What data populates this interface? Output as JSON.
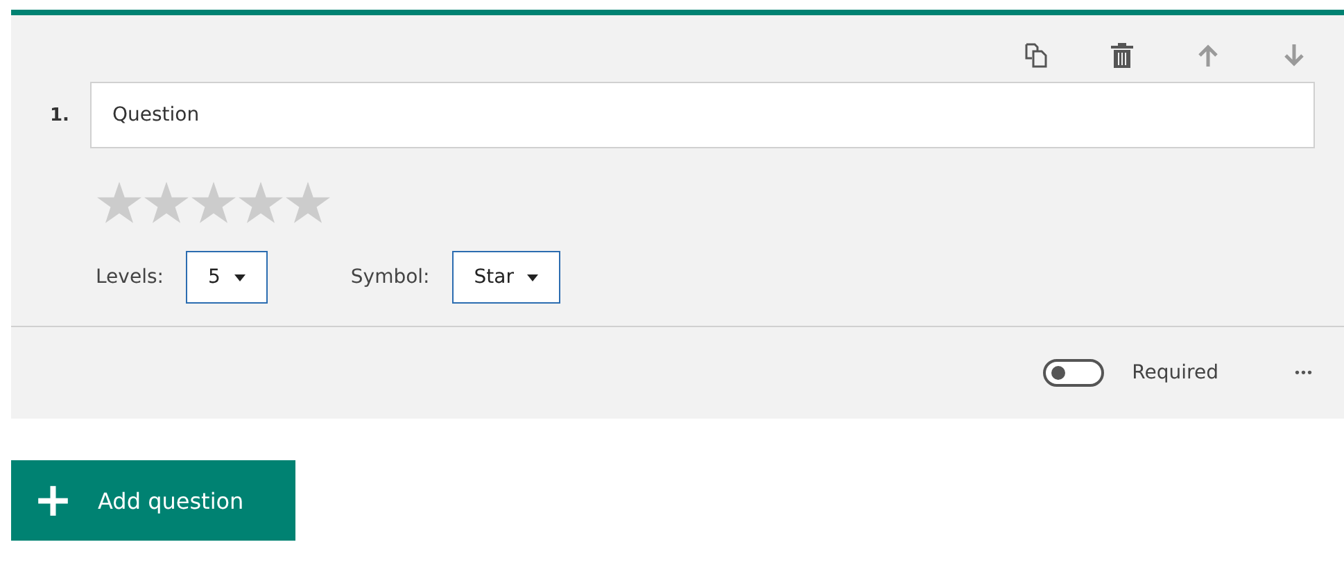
{
  "question": {
    "number": "1.",
    "placeholder": "Question",
    "stars": 0,
    "levels": {
      "label": "Levels:",
      "value": "5"
    },
    "symbol": {
      "label": "Symbol:",
      "value": "Star"
    },
    "required": {
      "label": "Required",
      "on": false
    },
    "more": "•••"
  },
  "add_button": {
    "label": "Add question",
    "plus": "+"
  }
}
